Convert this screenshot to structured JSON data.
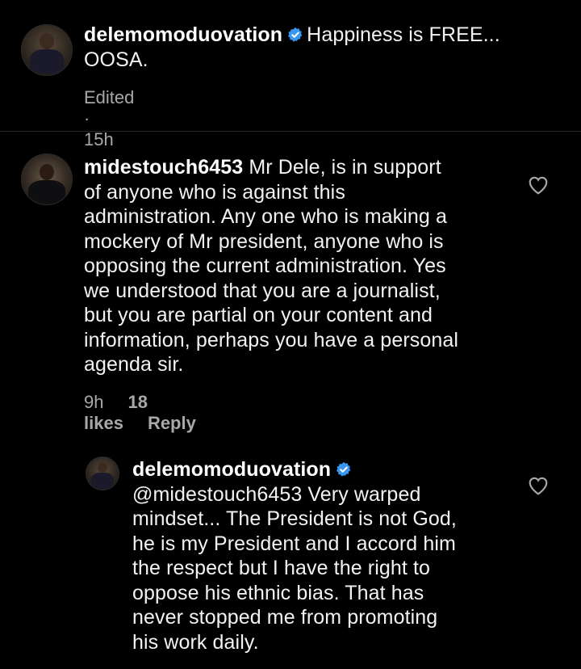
{
  "caption": {
    "username": "delemomoduovation",
    "text_line1": "Happiness is FREE...",
    "text_line2": "OOSA.",
    "edited": "Edited",
    "time": "15h"
  },
  "comment1": {
    "username": "midestouch6453",
    "lines": [
      "Mr Dele, is in support",
      "of anyone who is against this",
      "administration. Any one who is making a",
      "mockery of Mr president, anyone who is",
      "opposing the current administration. Yes",
      "we understood that you are a journalist,",
      "but you are partial on your content and",
      "information, perhaps you have a personal",
      "agenda sir."
    ],
    "time": "9h",
    "likes": "18 likes",
    "reply": "Reply"
  },
  "reply1": {
    "username": "delemomoduovation",
    "lines": [
      "@midestouch6453 Very warped",
      "mindset... The President is not God,",
      "he is my President and I accord him",
      "the respect but I have the right to",
      "oppose his ethnic bias. That has",
      "never stopped me from promoting",
      "his work daily."
    ]
  },
  "colors": {
    "background": "#000000",
    "text": "#f2f2f2",
    "meta": "#a8a8a8",
    "verified": "#3897f0"
  },
  "icons": {
    "verified": "verified-badge-icon",
    "like": "heart-outline-icon"
  }
}
